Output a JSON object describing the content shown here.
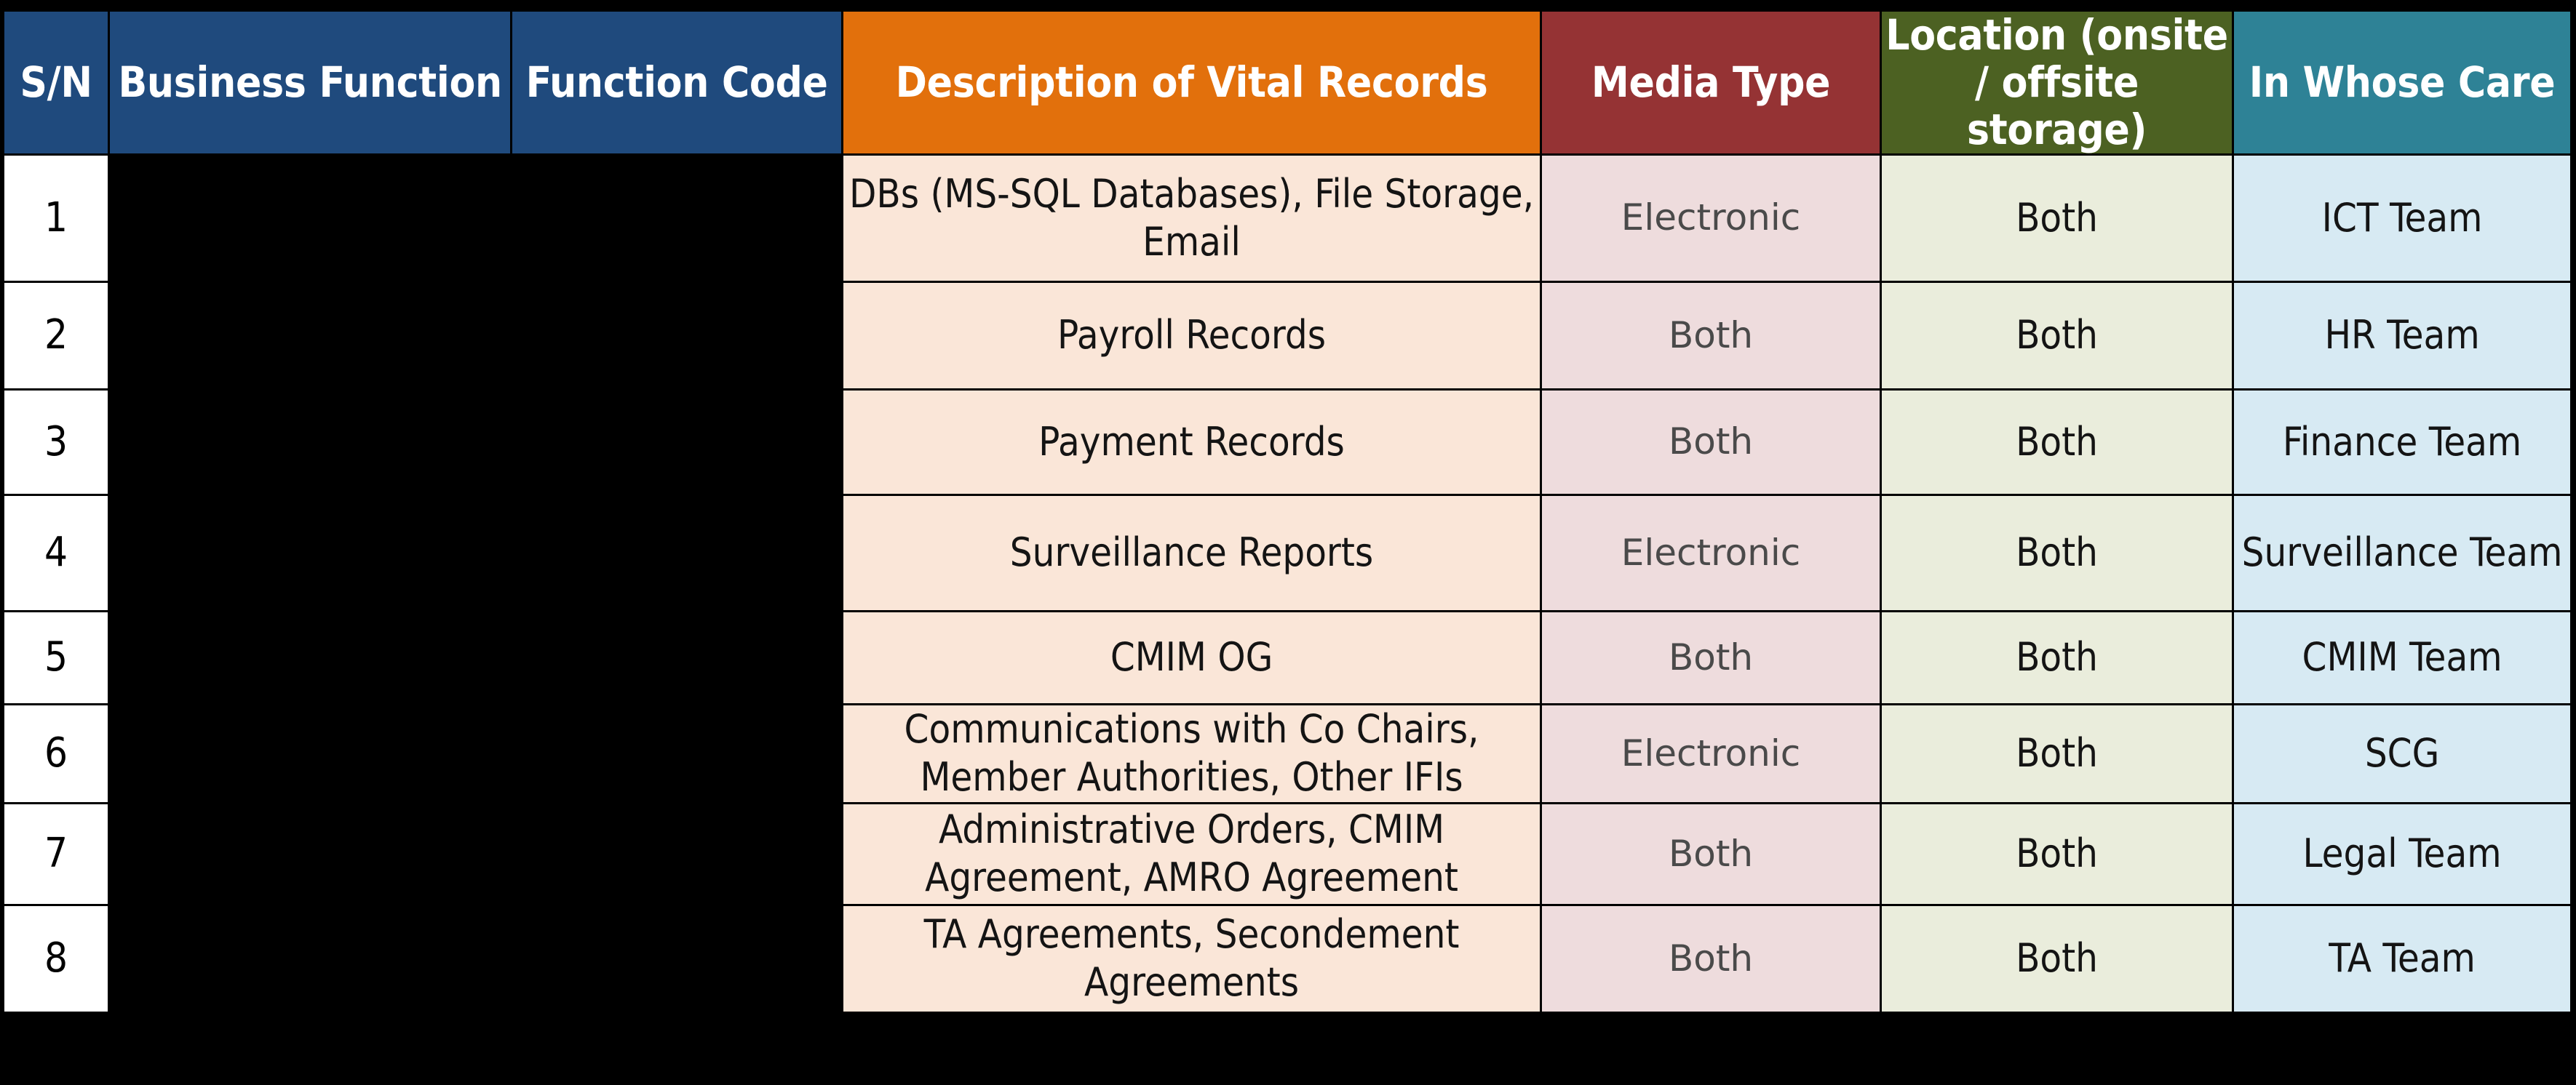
{
  "table": {
    "headers": {
      "sn": "S/N",
      "business_function": "Business Function",
      "function_code": "Function Code",
      "description": "Description of Vital Records",
      "media_type": "Media Type",
      "location_line1": "Location  (onsite",
      "location_line2": "/ offsite storage)",
      "in_whose_care": "In Whose Care"
    },
    "header_colors": {
      "sn": "#1f4a7d",
      "business_function": "#1f4a7d",
      "function_code": "#1f4a7d",
      "description": "#e2700c",
      "media_type": "#953334",
      "location": "#4c6122",
      "in_whose_care": "#2e8296"
    },
    "body_colors": {
      "sn": "#ffffff",
      "redacted": "#000000",
      "description": "#fae6d8",
      "media_type": "#eedcdd",
      "location": "#eaeddc",
      "in_whose_care": "#d7eaf3"
    },
    "rows": [
      {
        "sn": "1",
        "business_function": "",
        "function_code": "",
        "description": "DBs (MS-SQL Databases), File Storage, Email",
        "media_type": "Electronic",
        "location": "Both",
        "in_whose_care": "ICT Team"
      },
      {
        "sn": "2",
        "business_function": "",
        "function_code": "",
        "description": "Payroll Records",
        "media_type": "Both",
        "location": "Both",
        "in_whose_care": "HR Team"
      },
      {
        "sn": "3",
        "business_function": "",
        "function_code": "",
        "description": "Payment Records",
        "media_type": "Both",
        "location": "Both",
        "in_whose_care": "Finance Team"
      },
      {
        "sn": "4",
        "business_function": "",
        "function_code": "",
        "description": "Surveillance Reports",
        "media_type": "Electronic",
        "location": "Both",
        "in_whose_care": "Surveillance Team"
      },
      {
        "sn": "5",
        "business_function": "",
        "function_code": "",
        "description": "CMIM OG",
        "media_type": "Both",
        "location": "Both",
        "in_whose_care": "CMIM Team"
      },
      {
        "sn": "6",
        "business_function": "",
        "function_code": "",
        "description": "Communications with Co Chairs, Member Authorities, Other IFIs",
        "media_type": "Electronic",
        "location": "Both",
        "in_whose_care": "SCG"
      },
      {
        "sn": "7",
        "business_function": "",
        "function_code": "",
        "description": "Administrative Orders, CMIM Agreement, AMRO Agreement",
        "media_type": "Both",
        "location": "Both",
        "in_whose_care": "Legal Team"
      },
      {
        "sn": "8",
        "business_function": "",
        "function_code": "",
        "description": "TA Agreements, Secondement Agreements",
        "media_type": "Both",
        "location": "Both",
        "in_whose_care": "TA Team"
      }
    ]
  }
}
